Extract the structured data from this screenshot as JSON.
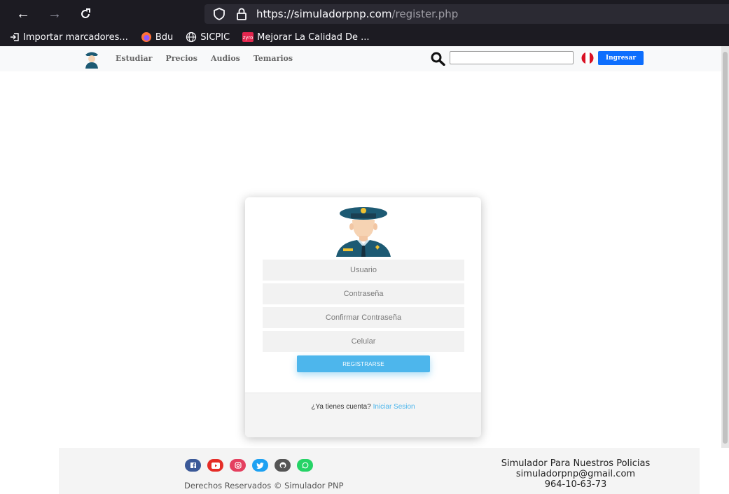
{
  "browser": {
    "url_host": "https://simuladorpnp.com",
    "url_path": "/register.php",
    "bookmarks": [
      {
        "label": "Importar marcadores...",
        "icon": "import-icon"
      },
      {
        "label": "Bdu",
        "icon": "firefox-icon"
      },
      {
        "label": "SICPIC",
        "icon": "globe-icon"
      },
      {
        "label": "Mejorar La Calidad De ...",
        "icon": "zyro-icon"
      }
    ]
  },
  "nav": {
    "links": [
      "Estudiar",
      "Precios",
      "Audios",
      "Temarios"
    ],
    "search_value": "",
    "login_button": "Ingresar"
  },
  "form": {
    "usuario_placeholder": "Usuario",
    "contrasena_placeholder": "Contraseña",
    "confirmar_placeholder": "Confirmar Contraseña",
    "celular_placeholder": "Celular",
    "submit_label": "REGISTRARSE",
    "have_account_text": "¿Ya tienes cuenta?",
    "login_link": "Iniciar Sesion"
  },
  "footer": {
    "rights": "Derechos Reservados © Simulador PNP",
    "title": "Simulador Para Nuestros Policias",
    "email": "simuladorpnp@gmail.com",
    "phone": "964-10-63-73",
    "social": [
      {
        "name": "facebook-icon",
        "color": "#3b5998"
      },
      {
        "name": "youtube-icon",
        "color": "#e52d27"
      },
      {
        "name": "instagram-icon",
        "color": "#e4405f"
      },
      {
        "name": "twitter-icon",
        "color": "#1da1f2"
      },
      {
        "name": "github-icon",
        "color": "#555555"
      },
      {
        "name": "whatsapp-icon",
        "color": "#25d366"
      }
    ]
  },
  "colors": {
    "accent": "#4db6ec",
    "primary_button": "#0d6efd"
  }
}
